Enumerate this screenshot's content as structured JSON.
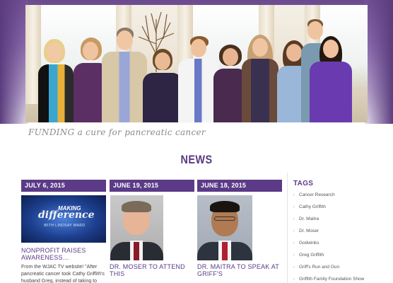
{
  "hero": {
    "tagline": "FUNDING a cure for pancreatic cancer"
  },
  "news": {
    "heading": "NEWS",
    "posts": [
      {
        "date": "JULY 6, 2015",
        "image_text_top": "MAKING",
        "image_text_main": "difference",
        "image_text_sub": "WITH LINDSAY WARD",
        "title": "NONPROFIT RAISES AWARENESS…",
        "excerpt": "From the WJAC TV website! \"After pancreatic cancer took Cathy Griffith's husband Greg, instead of taking to road"
      },
      {
        "date": "JUNE 19, 2015",
        "title": "DR. MOSER TO ATTEND THIS",
        "excerpt": ""
      },
      {
        "date": "JUNE 18, 2015",
        "title": "DR. MAITRA TO SPEAK AT GRIFF'S",
        "excerpt": ""
      }
    ]
  },
  "sidebar": {
    "tags_heading": "TAGS",
    "tags": [
      "Cancer Research",
      "Cathy Griffith",
      "Dr. Maitra",
      "Dr. Moser",
      "Godwinks",
      "Greg Griffith",
      "Griff's Run and Gun",
      "Griffith Family Foundation Show"
    ]
  },
  "colors": {
    "brand_purple": "#5b3a87",
    "hero_purple": "#6b4a8e"
  }
}
